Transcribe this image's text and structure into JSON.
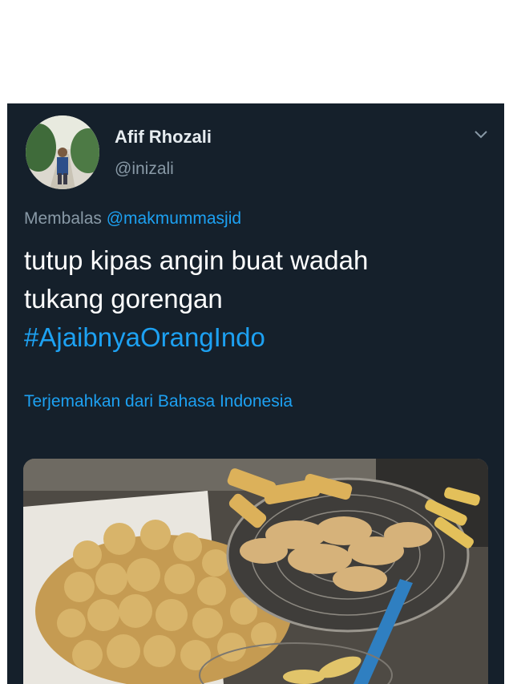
{
  "tweet": {
    "author_name": "Afif Rhozali",
    "author_handle": "@inizali",
    "reply_prefix": "Membalas",
    "reply_mention": "@makmummasjid",
    "text_lines": [
      "tutup kipas angin buat wadah",
      "tukang gorengan"
    ],
    "hashtag": "#AjaibnyaOrangIndo",
    "translate_label": "Terjemahkan dari Bahasa Indonesia",
    "menu_icon": "chevron-down-icon"
  },
  "colors": {
    "background": "#15202b",
    "link": "#1da1f2",
    "secondary_text": "#8899a6",
    "primary_text": "#ffffff"
  }
}
